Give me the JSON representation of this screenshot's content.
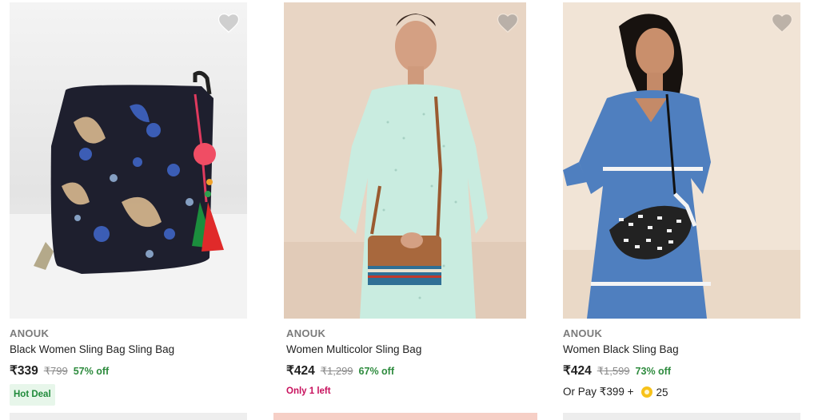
{
  "products": [
    {
      "brand": "ANOUK",
      "title": "Black Women Sling Bag Sling Bag",
      "price": "₹339",
      "mrp": "₹799",
      "discount": "57% off",
      "tag": "Hot Deal",
      "image_icon": "printed-sling-bag-image"
    },
    {
      "brand": "ANOUK",
      "title": "Women Multicolor Sling Bag",
      "price": "₹424",
      "mrp": "₹1,299",
      "discount": "67% off",
      "stock_note": "Only 1 left",
      "image_icon": "model-with-brown-sling-bag-image"
    },
    {
      "brand": "ANOUK",
      "title": "Women Black Sling Bag",
      "price": "₹424",
      "mrp": "₹1,599",
      "discount": "73% off",
      "or_pay_label": "Or Pay ₹399 +",
      "coins": "25",
      "image_icon": "model-with-woven-sling-bag-image"
    }
  ],
  "wishlist_icon": "heart-icon",
  "colors": {
    "discount_green": "#2e8b3e",
    "hot_deal_bg": "#e7f6ea",
    "stock_pink": "#c8115d",
    "coin_yellow": "#f7c21a"
  }
}
